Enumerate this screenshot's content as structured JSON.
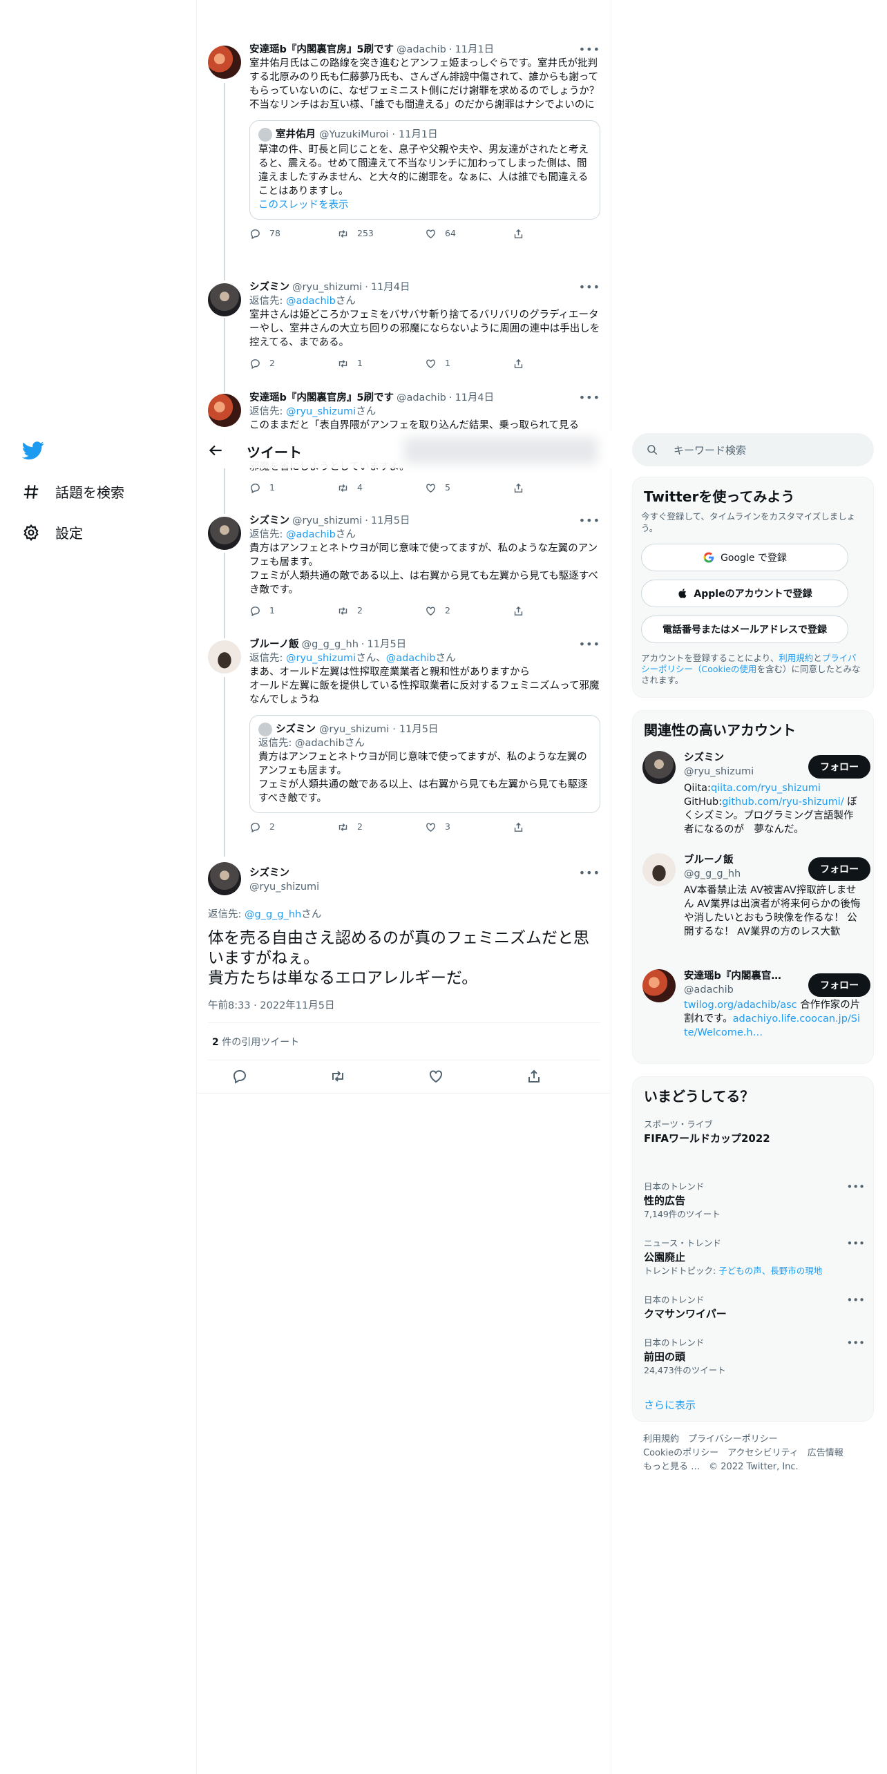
{
  "nav": {
    "items": [
      {
        "label": "話題を検索",
        "icon": "hashtag-icon"
      },
      {
        "label": "設定",
        "icon": "gear-icon"
      }
    ]
  },
  "header": {
    "title": "ツイート"
  },
  "thread": [
    {
      "name": "安達瑶b『内閣裏官房』5刷です",
      "handle": "@adachib",
      "date": "11月1日",
      "text": "室井佑月氏はこの路線を突き進むとアンフェ姫まっしぐらです。室井氏が批判する北原みのり氏も仁藤夢乃氏も、さんざん誹謗中傷されて、誰からも謝ってもらっていないのに、なぜフェミニスト側にだけ謝罪を求めるのでしょうか？不当なリンチはお互い様、「誰でも間違える」のだから謝罪はナシでよいのに",
      "quote": {
        "name": "室井佑月",
        "handle": "@YuzukiMuroi",
        "date": "11月1日",
        "text": "草津の件、町長と同じことを、息子や父親や夫や、男友達がされたと考えると、震える。せめて間違えて不当なリンチに加わってしまった側は、間違えましたすみません、と大々的に謝罪を。なぁに、人は誰でも間違えることはありますし。",
        "link": "このスレッドを表示"
      },
      "replies": "78",
      "retweets": "253",
      "likes": "64"
    },
    {
      "name": "シズミン",
      "handle": "@ryu_shizumi",
      "date": "11月4日",
      "reply_prefix": "返信先: ",
      "reply_to": "@adachib",
      "reply_suffix": "さん",
      "text": "室井さんは姫どころかフェミをバサバサ斬り捨てるバリバリのグラディエーターやし、室井さんの大立ち回りの邪魔にならないように周囲の連中は手出しを控えてる、まである。",
      "replies": "2",
      "retweets": "1",
      "likes": "1"
    },
    {
      "name": "安達瑶b『内閣裏官房』5刷です",
      "handle": "@adachib",
      "date": "11月4日",
      "reply_prefix": "返信先: ",
      "reply_to": "@ryu_shizumi",
      "reply_suffix": "さん",
      "text_top": "このままだと「表自界隈がアンフェを取り込んだ結果、乗っ取られて見る",
      "text_bottom": "邪魔を省にしようとしていますよ。",
      "replies": "1",
      "retweets": "4",
      "likes": "5"
    },
    {
      "name": "シズミン",
      "handle": "@ryu_shizumi",
      "date": "11月5日",
      "reply_prefix": "返信先: ",
      "reply_to": "@adachib",
      "reply_suffix": "さん",
      "text": "貴方はアンフェとネトウヨが同じ意味で使ってますが、私のような左翼のアンフェも居ます。\nフェミが人類共通の敵である以上、は右翼から見ても左翼から見ても駆逐すべき敵です。",
      "replies": "1",
      "retweets": "2",
      "likes": "2"
    },
    {
      "name": "ブルーノ飯",
      "handle": "@g_g_g_hh",
      "date": "11月5日",
      "reply_prefix": "返信先: ",
      "reply_to": "@ryu_shizumi",
      "reply_mid": "さん、",
      "reply_to2": "@adachib",
      "reply_suffix": "さん",
      "text": "まあ、オールド左翼は性搾取産業業者と親和性がありますから\nオールド左翼に飯を提供している性搾取業者に反対するフェミニズムって邪魔なんでしょうね",
      "quote": {
        "name": "シズミン",
        "handle": "@ryu_shizumi",
        "date": "11月5日",
        "reply": "返信先: @adachibさん",
        "text": "貴方はアンフェとネトウヨが同じ意味で使ってますが、私のような左翼のアンフェも居ます。\nフェミが人類共通の敵である以上、は右翼から見ても左翼から見ても駆逐すべき敵です。"
      },
      "replies": "2",
      "retweets": "2",
      "likes": "3"
    }
  ],
  "focus": {
    "name": "シズミン",
    "handle": "@ryu_shizumi",
    "reply_prefix": "返信先: ",
    "reply_to": "@g_g_g_hh",
    "reply_mid": "さん、",
    "reply_to2": "@adachib",
    "reply_suffix": "さん",
    "text": "体を売る自由さえ認めるのが真のフェミニズムだと思いますがねぇ。\n貴方たちは単なるエロアレルギーだ。",
    "timestamp": "午前8:33 · 2022年11月5日",
    "quote_count": "2",
    "quote_label": " 件の引用ツイート"
  },
  "right": {
    "search_placeholder": "キーワード検索",
    "signup": {
      "title": "Twitterを使ってみよう",
      "sub": "今すぐ登録して、タイムラインをカスタマイズしましょう。",
      "google": "Google で登録",
      "apple": "Appleのアカウントで登録",
      "phone": "電話番号またはメールアドレスで登録",
      "legal_1": "アカウントを登録することにより、",
      "legal_terms": "利用規約",
      "legal_2": "と",
      "legal_privacy": "プライバシーポリシー（Cookieの使用",
      "legal_3": "を含む）に同意したとみなされます。"
    },
    "related": {
      "title": "関連性の高いアカウント",
      "follow_label": "フォロー",
      "accounts": [
        {
          "name": "シズミン",
          "handle": "@ryu_shizumi",
          "bio_pre": "Qiita:",
          "bio_link1": "qiita.com/ryu_shizumi",
          "bio_mid": "GitHub:",
          "bio_link2": "github.com/ryu-shizumi/",
          "bio_post": " ぼくシズミン。プログラミング言語製作者になるのが　夢なんだ。"
        },
        {
          "name": "ブルーノ飯",
          "handle": "@g_g_g_hh",
          "bio": "AV本番禁止法 AV被害AV搾取許しません AV業界は出演者が将来何らかの後悔や消したいとおもう映像を作るな！ 公開するな！ AV業界の方のレス大歓"
        },
        {
          "name": "安達瑶b『内閣裏官…",
          "handle": "@adachib",
          "bio_link1": "twilog.org/adachib/asc",
          "bio_mid": " 合作作家の片割れです。",
          "bio_link2": "adachiyo.life.coocan.jp/Site/Welcome.h…"
        }
      ]
    },
    "trends": {
      "title": "いまどうしてる？",
      "items": [
        {
          "category": "スポーツ・ライブ",
          "name": "FIFAワールドカップ2022",
          "count": ""
        },
        {
          "category": "日本のトレンド",
          "name": "性的広告",
          "count": "7,149件のツイート"
        },
        {
          "category": "ニュース・トレンド",
          "name": "公園廃止",
          "count_pre": "トレンドトピック: ",
          "count_link": "子どもの声、長野市の現地"
        },
        {
          "category": "日本のトレンド",
          "name": "クマサンワイパー",
          "count": ""
        },
        {
          "category": "日本のトレンド",
          "name": "前田の頭",
          "count": "24,473件のツイート"
        }
      ],
      "show_more": "さらに表示"
    },
    "footer": {
      "line1": "利用規約　プライバシーポリシー",
      "line2": "Cookieのポリシー　アクセシビリティ　広告情報",
      "line3_more": "もっと見る …",
      "line3_copy": "© 2022 Twitter, Inc."
    }
  }
}
